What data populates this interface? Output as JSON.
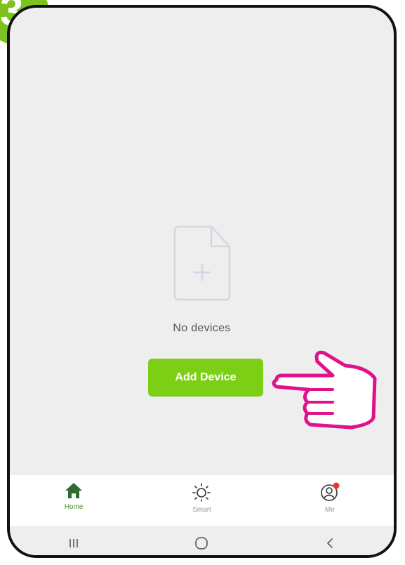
{
  "step_badge": "3",
  "main": {
    "empty_text": "No devices",
    "add_device_label": "Add Device"
  },
  "tabs": [
    {
      "label": "Home",
      "icon": "home-icon",
      "active": true
    },
    {
      "label": "Smart",
      "icon": "sun-icon",
      "active": false
    },
    {
      "label": "Me",
      "icon": "profile-icon",
      "active": false,
      "badge": true
    }
  ],
  "system_nav": [
    "recents-icon",
    "home-circle-icon",
    "back-icon"
  ],
  "colors": {
    "accent": "#7ccf14",
    "active_tab": "#4e8f2c",
    "pointer_hand": "#e0118a",
    "notification_dot": "#e53935"
  }
}
